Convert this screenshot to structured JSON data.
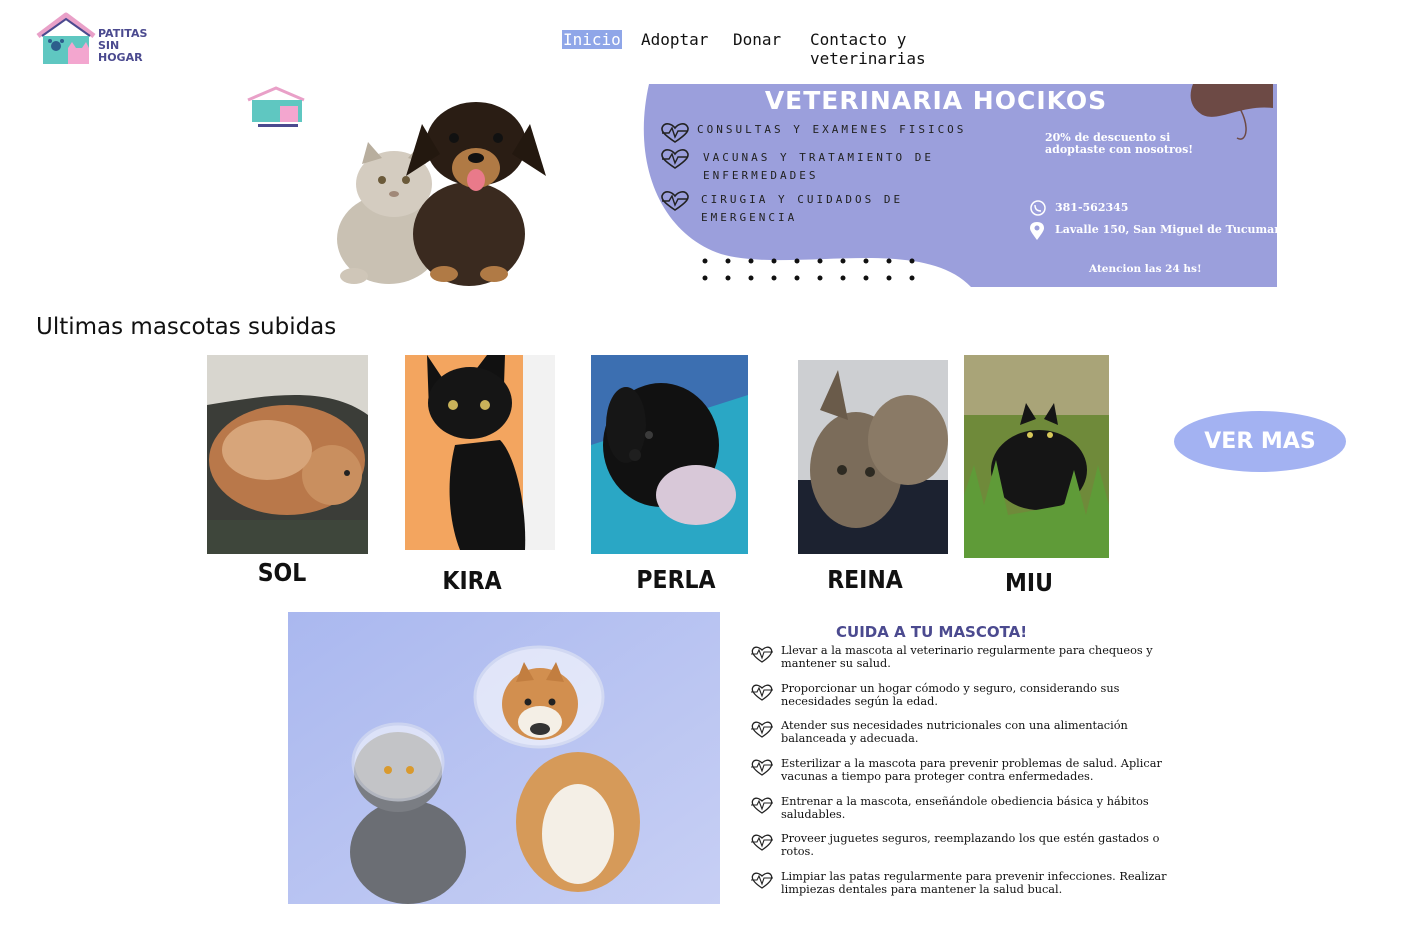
{
  "brand": {
    "name_line1": "PATITAS",
    "name_line2": "SIN HOGAR"
  },
  "nav": {
    "items": [
      {
        "label": "Inicio",
        "active": true
      },
      {
        "label": "Adoptar",
        "active": false
      },
      {
        "label": "Donar",
        "active": false
      },
      {
        "label": "Contacto y veterinarias",
        "active": false
      }
    ]
  },
  "hero": {
    "vet": {
      "title": "VETERINARIA HOCIKOS",
      "services": [
        "CONSULTAS Y EXAMENES FISICOS",
        "VACUNAS Y TRATAMIENTO DE ENFERMEDADES",
        "CIRUGIA Y CUIDADOS DE EMERGENCIA"
      ],
      "promo": "20% de descuento si adoptaste con nosotros!",
      "phone": "381-562345",
      "address": "Lavalle 150, San Miguel de Tucuman",
      "hours": "Atencion las 24 hs!"
    }
  },
  "pets": {
    "section_title": "Ultimas mascotas subidas",
    "items": [
      {
        "name": "SOL"
      },
      {
        "name": "KIRA"
      },
      {
        "name": "PERLA"
      },
      {
        "name": "REINA"
      },
      {
        "name": "MIU"
      }
    ],
    "more_button": "VER MAS"
  },
  "care": {
    "title": "CUIDA A TU MASCOTA!",
    "tips": [
      "Llevar a la mascota al veterinario regularmente para chequeos y mantener su salud.",
      "Proporcionar un hogar cómodo y seguro, considerando sus necesidades según la edad.",
      "Atender sus necesidades nutricionales con una alimentación balanceada y adecuada.",
      "Esterilizar a la mascota para prevenir problemas de salud. Aplicar vacunas a tiempo para proteger contra enfermedades.",
      "Entrenar a la mascota, enseñándole obediencia básica y hábitos saludables.",
      "Proveer juguetes seguros, reemplazando los que estén gastados o rotos.",
      "Limpiar las patas regularmente para prevenir infecciones. Realizar limpiezas dentales para mantener la salud bucal."
    ]
  },
  "colors": {
    "accent": "#8fa6e8",
    "banner_purple": "#9b9fdc",
    "brand_purple": "#4b4a8f",
    "button_blue": "#a3b2f2"
  }
}
